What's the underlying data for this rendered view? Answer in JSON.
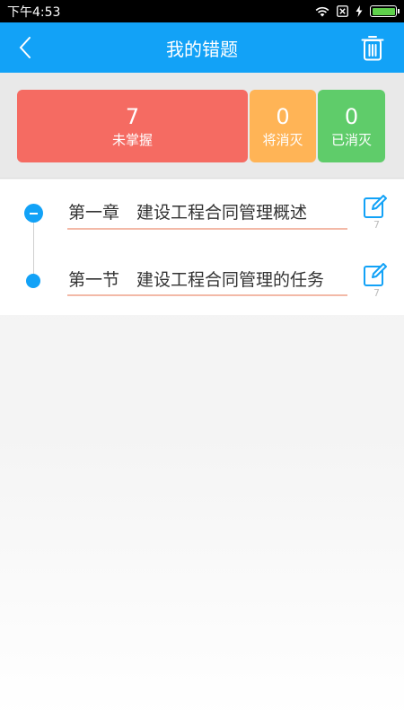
{
  "status_bar": {
    "time": "下午4:53"
  },
  "header": {
    "title": "我的错题",
    "back_icon": "chevron-left-icon",
    "trash_icon": "trash-icon"
  },
  "stats": [
    {
      "value": "7",
      "label": "未掌握",
      "color": "#f56b62"
    },
    {
      "value": "0",
      "label": "将消灭",
      "color": "#ffb456"
    },
    {
      "value": "0",
      "label": "已消灭",
      "color": "#5fcc6a"
    }
  ],
  "tree": {
    "chapter": {
      "title": "第一章　建设工程合同管理概述",
      "count": "7",
      "expanded": true
    },
    "section": {
      "title": "第一节　建设工程合同管理的任务",
      "count": "7"
    }
  },
  "colors": {
    "accent": "#12a2f7",
    "underline": "#f3b9a7"
  }
}
